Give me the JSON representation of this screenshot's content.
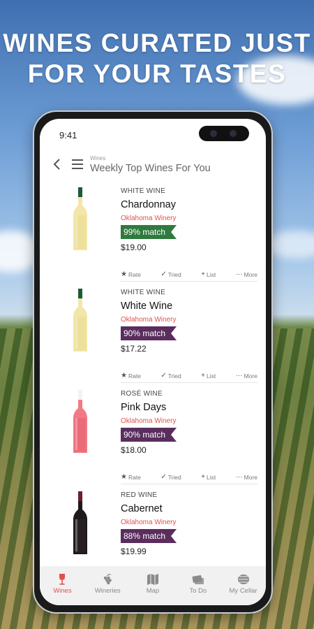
{
  "headline": {
    "line1": "WINES CURATED JUST",
    "line2": "FOR YOUR TASTES"
  },
  "status": {
    "time": "9:41"
  },
  "header": {
    "breadcrumb": "Wines",
    "title": "Weekly Top Wines For You"
  },
  "colors": {
    "accent": "#e2504f",
    "match_green": "#2f7a3d",
    "match_purple": "#5a2d5e",
    "tab_active": "#e2504f"
  },
  "wines": [
    {
      "type": "WHITE WINE",
      "name": "Chardonnay",
      "winery": "Oklahoma Winery",
      "match": "99% match",
      "match_color": "#2f7a3d",
      "price": "$19.00",
      "bottle": "white"
    },
    {
      "type": "WHITE WINE",
      "name": "White Wine",
      "winery": "Oklahoma Winery",
      "match": "90% match",
      "match_color": "#5a2d5e",
      "price": "$17.22",
      "bottle": "white"
    },
    {
      "type": "ROSÉ WINE",
      "name": "Pink Days",
      "winery": "Oklahoma Winery",
      "match": "90% match",
      "match_color": "#5a2d5e",
      "price": "$18.00",
      "bottle": "rose"
    },
    {
      "type": "RED WINE",
      "name": "Cabernet",
      "winery": "Oklahoma Winery",
      "match": "88% match",
      "match_color": "#5a2d5e",
      "price": "$19.99",
      "bottle": "red"
    }
  ],
  "actions": {
    "rate": "Rate",
    "tried": "Tried",
    "list": "List",
    "more": "More"
  },
  "tabs": [
    {
      "label": "Wines",
      "icon": "wine-glass-icon",
      "active": true
    },
    {
      "label": "Wineries",
      "icon": "grapes-icon",
      "active": false
    },
    {
      "label": "Map",
      "icon": "map-icon",
      "active": false
    },
    {
      "label": "To Do",
      "icon": "ticket-icon",
      "active": false
    },
    {
      "label": "My Cellar",
      "icon": "barrel-icon",
      "active": false
    }
  ]
}
